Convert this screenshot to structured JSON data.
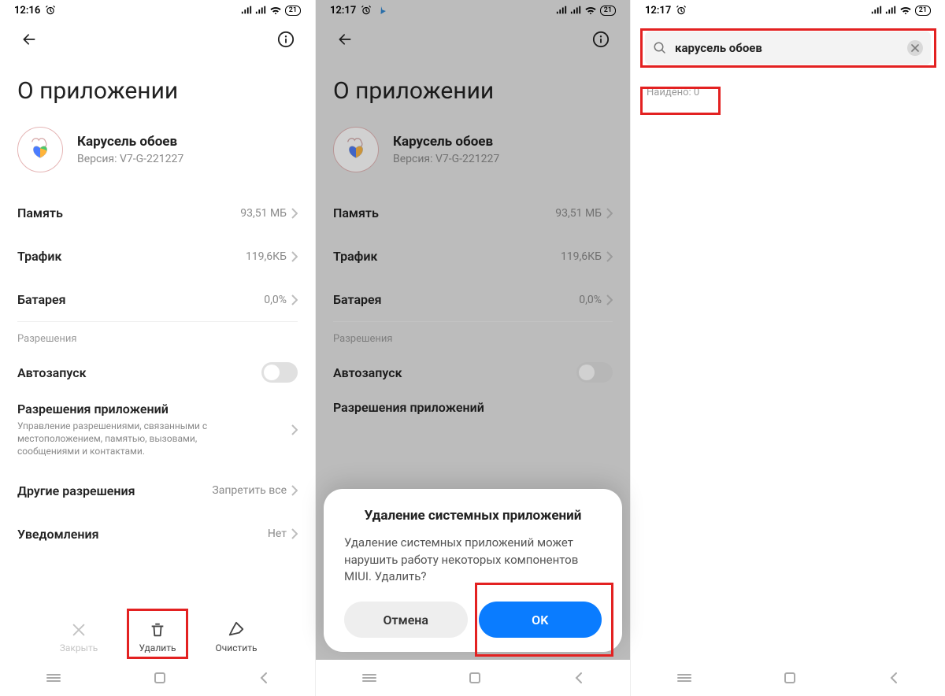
{
  "screens": {
    "s1": {
      "status": {
        "time": "12:16",
        "battery": "21"
      },
      "title": "О приложении",
      "app": {
        "name": "Карусель обоев",
        "version": "Версия: V7-G-221227"
      },
      "rows": {
        "mem_label": "Память",
        "mem_value": "93,51 МБ",
        "traffic_label": "Трафик",
        "traffic_value": "119,6КБ",
        "battery_label": "Батарея",
        "battery_value": "0,0%"
      },
      "perm_section": "Разрешения",
      "autostart_label": "Автозапуск",
      "app_perm": {
        "label": "Разрешения приложений",
        "desc": "Управление разрешениями, связанными с местоположением, памятью, вызовами, сообщениями и контактами."
      },
      "other_perm_label": "Другие разрешения",
      "other_perm_value": "Запретить все",
      "notif_label": "Уведомления",
      "notif_value": "Нет",
      "actions": {
        "close": "Закрыть",
        "delete": "Удалить",
        "clear": "Очистить"
      }
    },
    "s2": {
      "status": {
        "time": "12:17",
        "battery": "21"
      },
      "title": "О приложении",
      "app": {
        "name": "Карусель обоев",
        "version": "Версия: V7-G-221227"
      },
      "rows": {
        "mem_label": "Память",
        "mem_value": "93,51 МБ",
        "traffic_label": "Трафик",
        "traffic_value": "119,6КБ",
        "battery_label": "Батарея",
        "battery_value": "0,0%"
      },
      "perm_section": "Разрешения",
      "autostart_label": "Автозапуск",
      "app_perm_label": "Разрешения приложений",
      "dialog": {
        "title": "Удаление системных приложений",
        "body": "Удаление системных приложений может нарушить работу некоторых компонентов MIUI. Удалить?",
        "cancel": "Отмена",
        "ok": "OK"
      }
    },
    "s3": {
      "status": {
        "time": "12:17",
        "battery": "21"
      },
      "search_text": "карусель обоев",
      "found": "Найдено: 0"
    }
  }
}
